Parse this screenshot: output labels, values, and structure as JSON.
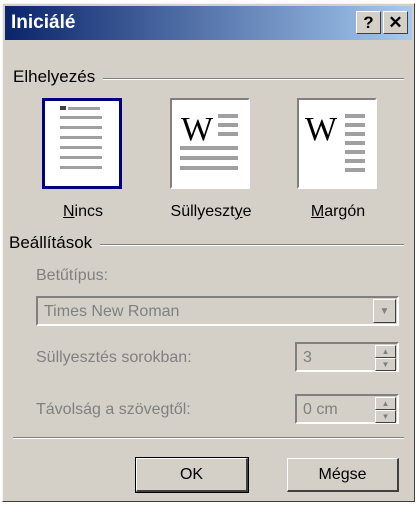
{
  "dialog": {
    "title": "Iniciálé",
    "help_button": "?",
    "close_button": "✕"
  },
  "placement": {
    "group_label": "Elhelyezés",
    "options": [
      {
        "label_pre": "",
        "label_ul": "N",
        "label_post": "incs",
        "selected": true
      },
      {
        "label_pre": "Süllyeszt",
        "label_ul": "y",
        "label_post": "e",
        "selected": false
      },
      {
        "label_pre": "",
        "label_ul": "M",
        "label_post": "argón",
        "selected": false
      }
    ]
  },
  "settings": {
    "group_label": "Beállítások",
    "font_label": "Betűtípus:",
    "font_value": "Times New Roman",
    "lines_label": "Süllyesztés sorokban:",
    "lines_value": "3",
    "distance_label": "Távolság a szövegtől:",
    "distance_value": "0 cm"
  },
  "buttons": {
    "ok": "OK",
    "cancel": "Mégse"
  },
  "colors": {
    "title_start": "#0a246a",
    "title_end": "#a6caf0",
    "face": "#d4d0c8",
    "selection": "#000080"
  }
}
